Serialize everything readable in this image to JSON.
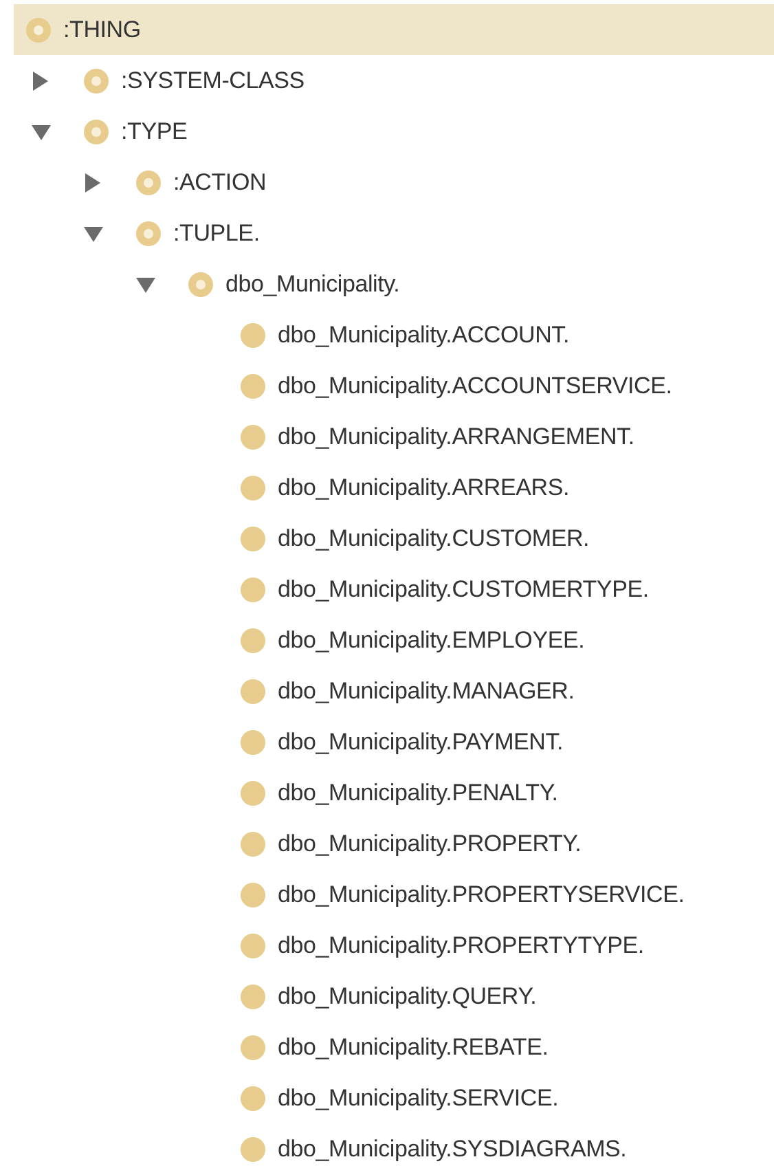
{
  "tree": [
    {
      "label": ":THING",
      "kind": "root",
      "selected": true,
      "children": [
        {
          "label": ":SYSTEM-CLASS",
          "kind": "branch",
          "expanded": false,
          "selected": false
        },
        {
          "label": ":TYPE",
          "kind": "branch",
          "expanded": true,
          "selected": false,
          "children": [
            {
              "label": ":ACTION",
              "kind": "branch",
              "expanded": false,
              "selected": false
            },
            {
              "label": ":TUPLE.",
              "kind": "branch",
              "expanded": true,
              "selected": false,
              "children": [
                {
                  "label": "dbo_Municipality.",
                  "kind": "branch",
                  "expanded": true,
                  "selected": false,
                  "children": [
                    {
                      "label": "dbo_Municipality.ACCOUNT.",
                      "kind": "leaf",
                      "selected": false
                    },
                    {
                      "label": "dbo_Municipality.ACCOUNTSERVICE.",
                      "kind": "leaf",
                      "selected": false
                    },
                    {
                      "label": "dbo_Municipality.ARRANGEMENT.",
                      "kind": "leaf",
                      "selected": false
                    },
                    {
                      "label": "dbo_Municipality.ARREARS.",
                      "kind": "leaf",
                      "selected": false
                    },
                    {
                      "label": "dbo_Municipality.CUSTOMER.",
                      "kind": "leaf",
                      "selected": false
                    },
                    {
                      "label": "dbo_Municipality.CUSTOMERTYPE.",
                      "kind": "leaf",
                      "selected": false
                    },
                    {
                      "label": "dbo_Municipality.EMPLOYEE.",
                      "kind": "leaf",
                      "selected": false
                    },
                    {
                      "label": "dbo_Municipality.MANAGER.",
                      "kind": "leaf",
                      "selected": false
                    },
                    {
                      "label": "dbo_Municipality.PAYMENT.",
                      "kind": "leaf",
                      "selected": false
                    },
                    {
                      "label": "dbo_Municipality.PENALTY.",
                      "kind": "leaf",
                      "selected": false
                    },
                    {
                      "label": "dbo_Municipality.PROPERTY.",
                      "kind": "leaf",
                      "selected": false
                    },
                    {
                      "label": "dbo_Municipality.PROPERTYSERVICE.",
                      "kind": "leaf",
                      "selected": false
                    },
                    {
                      "label": "dbo_Municipality.PROPERTYTYPE.",
                      "kind": "leaf",
                      "selected": false
                    },
                    {
                      "label": "dbo_Municipality.QUERY.",
                      "kind": "leaf",
                      "selected": false
                    },
                    {
                      "label": "dbo_Municipality.REBATE.",
                      "kind": "leaf",
                      "selected": false
                    },
                    {
                      "label": "dbo_Municipality.SERVICE.",
                      "kind": "leaf",
                      "selected": false
                    },
                    {
                      "label": "dbo_Municipality.SYSDIAGRAMS.",
                      "kind": "leaf",
                      "selected": false
                    }
                  ]
                }
              ]
            }
          ]
        }
      ]
    }
  ]
}
